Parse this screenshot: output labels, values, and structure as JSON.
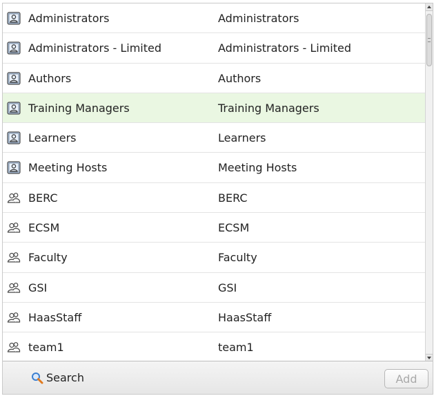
{
  "groups": [
    {
      "name": "Administrators",
      "login": "Administrators",
      "icon": "builtin-group-icon",
      "highlighted": false
    },
    {
      "name": "Administrators - Limited",
      "login": "Administrators - Limited",
      "icon": "builtin-group-icon",
      "highlighted": false
    },
    {
      "name": "Authors",
      "login": "Authors",
      "icon": "builtin-group-icon",
      "highlighted": false
    },
    {
      "name": "Training Managers",
      "login": "Training Managers",
      "icon": "builtin-group-icon",
      "highlighted": true
    },
    {
      "name": "Learners",
      "login": "Learners",
      "icon": "builtin-group-icon",
      "highlighted": false
    },
    {
      "name": "Meeting Hosts",
      "login": "Meeting Hosts",
      "icon": "builtin-group-icon",
      "highlighted": false
    },
    {
      "name": "BERC",
      "login": "BERC",
      "icon": "custom-group-icon",
      "highlighted": false
    },
    {
      "name": "ECSM",
      "login": "ECSM",
      "icon": "custom-group-icon",
      "highlighted": false
    },
    {
      "name": "Faculty",
      "login": "Faculty",
      "icon": "custom-group-icon",
      "highlighted": false
    },
    {
      "name": "GSI",
      "login": "GSI",
      "icon": "custom-group-icon",
      "highlighted": false
    },
    {
      "name": "HaasStaff",
      "login": "HaasStaff",
      "icon": "custom-group-icon",
      "highlighted": false
    },
    {
      "name": "team1",
      "login": "team1",
      "icon": "custom-group-icon",
      "highlighted": false
    }
  ],
  "footer": {
    "search_label": "Search",
    "search_icon": "magnifier-icon",
    "add_label": "Add",
    "add_enabled": false
  },
  "colors": {
    "highlight_row": "#eaf7e2",
    "row_divider": "#e3e3e3",
    "footer_bg": "#ececec",
    "search_icon_blue": "#3b7fd0"
  }
}
